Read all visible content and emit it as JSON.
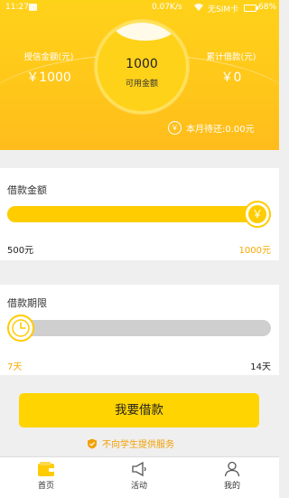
{
  "status_bar": {
    "time": "11:27",
    "network_speed": "0.07K/s",
    "sim": "无SIM卡",
    "battery": "68%"
  },
  "header": {
    "credit_label": "授信金额(元)",
    "credit_value": "￥1000",
    "available_value": "1000",
    "available_label": "可用金额",
    "cumulative_label": "累计借款(元)",
    "cumulative_value": "￥0",
    "monthly_due": "本月待还:0.00元",
    "coin_glyph": "￥"
  },
  "loan_amount": {
    "title": "借款金额",
    "min": "500元",
    "max": "1000元",
    "knob_glyph": "￥",
    "fill_fraction": 1.0
  },
  "loan_term": {
    "title": "借款期限",
    "min": "7天",
    "max": "14天",
    "fill_fraction": 0.0
  },
  "actions": {
    "borrow_button": "我要借款",
    "notice": "不向学生提供服务"
  },
  "tabs": [
    {
      "label": "首页",
      "icon": "wallet-icon",
      "active": true
    },
    {
      "label": "活动",
      "icon": "megaphone-icon",
      "active": false
    },
    {
      "label": "我的",
      "icon": "person-icon",
      "active": false
    }
  ],
  "colors": {
    "accent": "#ffcc00",
    "header_bg": "#ffc61a",
    "notice_text": "#f2a000"
  }
}
